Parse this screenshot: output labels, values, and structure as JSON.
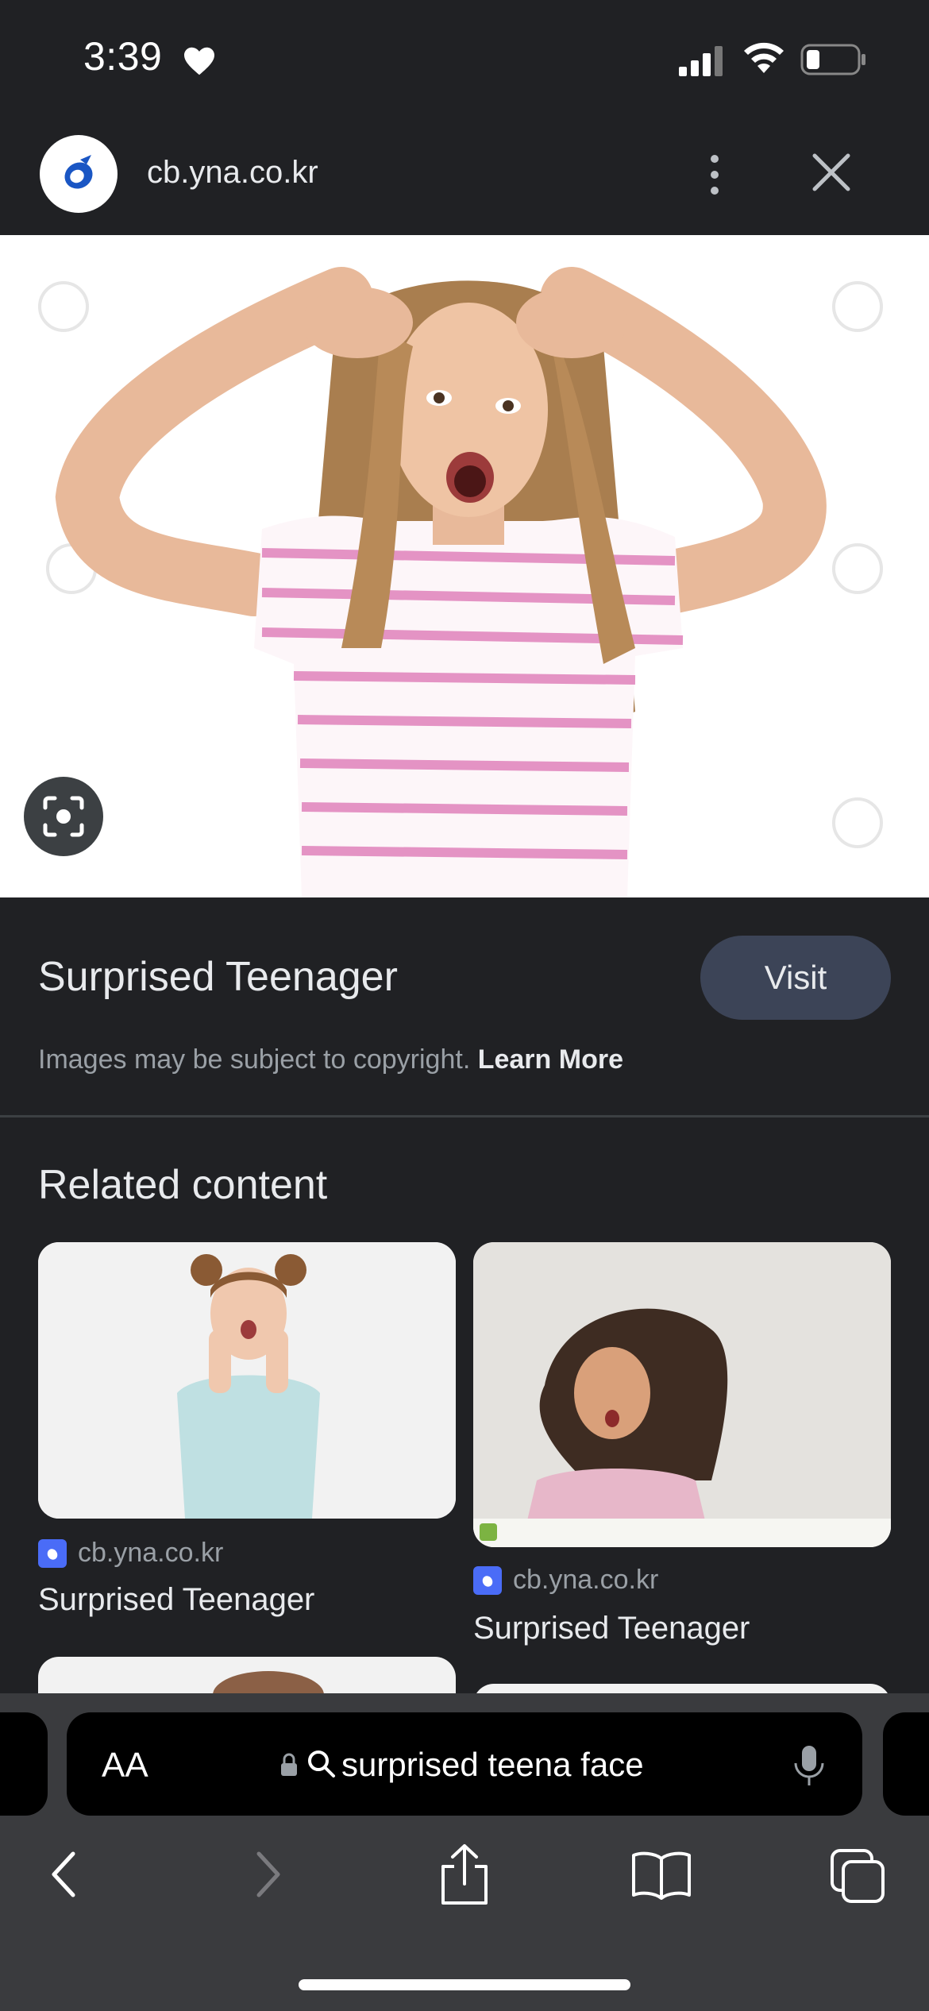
{
  "status_bar": {
    "time": "3:39"
  },
  "header": {
    "site_domain": "cb.yna.co.kr"
  },
  "image_info": {
    "title": "Surprised Teenager",
    "visit_label": "Visit",
    "copyright_text": "Images may be subject to copyright.",
    "learn_more_label": "Learn More"
  },
  "related": {
    "heading": "Related content",
    "cards": [
      {
        "source": "cb.yna.co.kr",
        "title": "Surprised Teenager"
      },
      {
        "source": "cb.yna.co.kr",
        "title": "Surprised Teenager"
      }
    ]
  },
  "browser": {
    "aa_label": "AA",
    "address_text": "surprised teena face"
  },
  "colors": {
    "background": "#202124",
    "visit_button": "#3c4457",
    "bottom_chrome": "#3a3b3e"
  }
}
